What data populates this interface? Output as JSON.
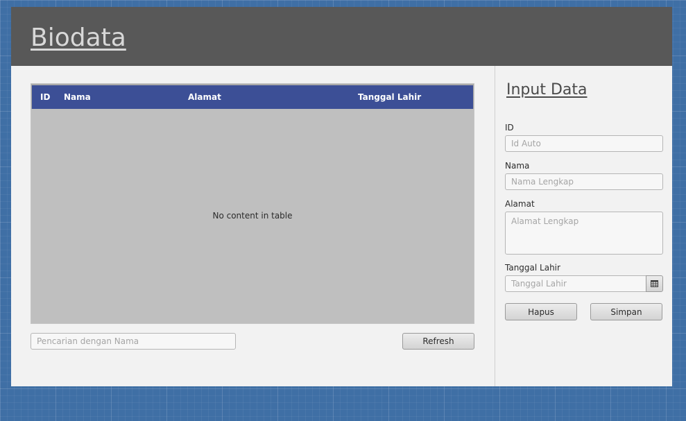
{
  "header": {
    "title": "Biodata"
  },
  "table": {
    "columns": [
      "ID",
      "Nama",
      "Alamat",
      "Tanggal Lahir"
    ],
    "empty_message": "No content in table",
    "header_color": "#3c4f96"
  },
  "search": {
    "placeholder": "Pencarian dengan Nama"
  },
  "refresh_button": {
    "label": "Refresh"
  },
  "form": {
    "title": "Input Data",
    "id": {
      "label": "ID",
      "placeholder": "Id Auto"
    },
    "nama": {
      "label": "Nama",
      "placeholder": "Nama Lengkap"
    },
    "alamat": {
      "label": "Alamat",
      "placeholder": "Alamat Lengkap"
    },
    "tanggal_lahir": {
      "label": "Tanggal Lahir",
      "placeholder": "Tanggal Lahir",
      "picker_icon": "calendar-icon"
    },
    "hapus_label": "Hapus",
    "simpan_label": "Simpan"
  },
  "colors": {
    "header_bg": "#585858",
    "panel_bg": "#f2f2f2",
    "desktop_bg": "#3f6fa5"
  }
}
